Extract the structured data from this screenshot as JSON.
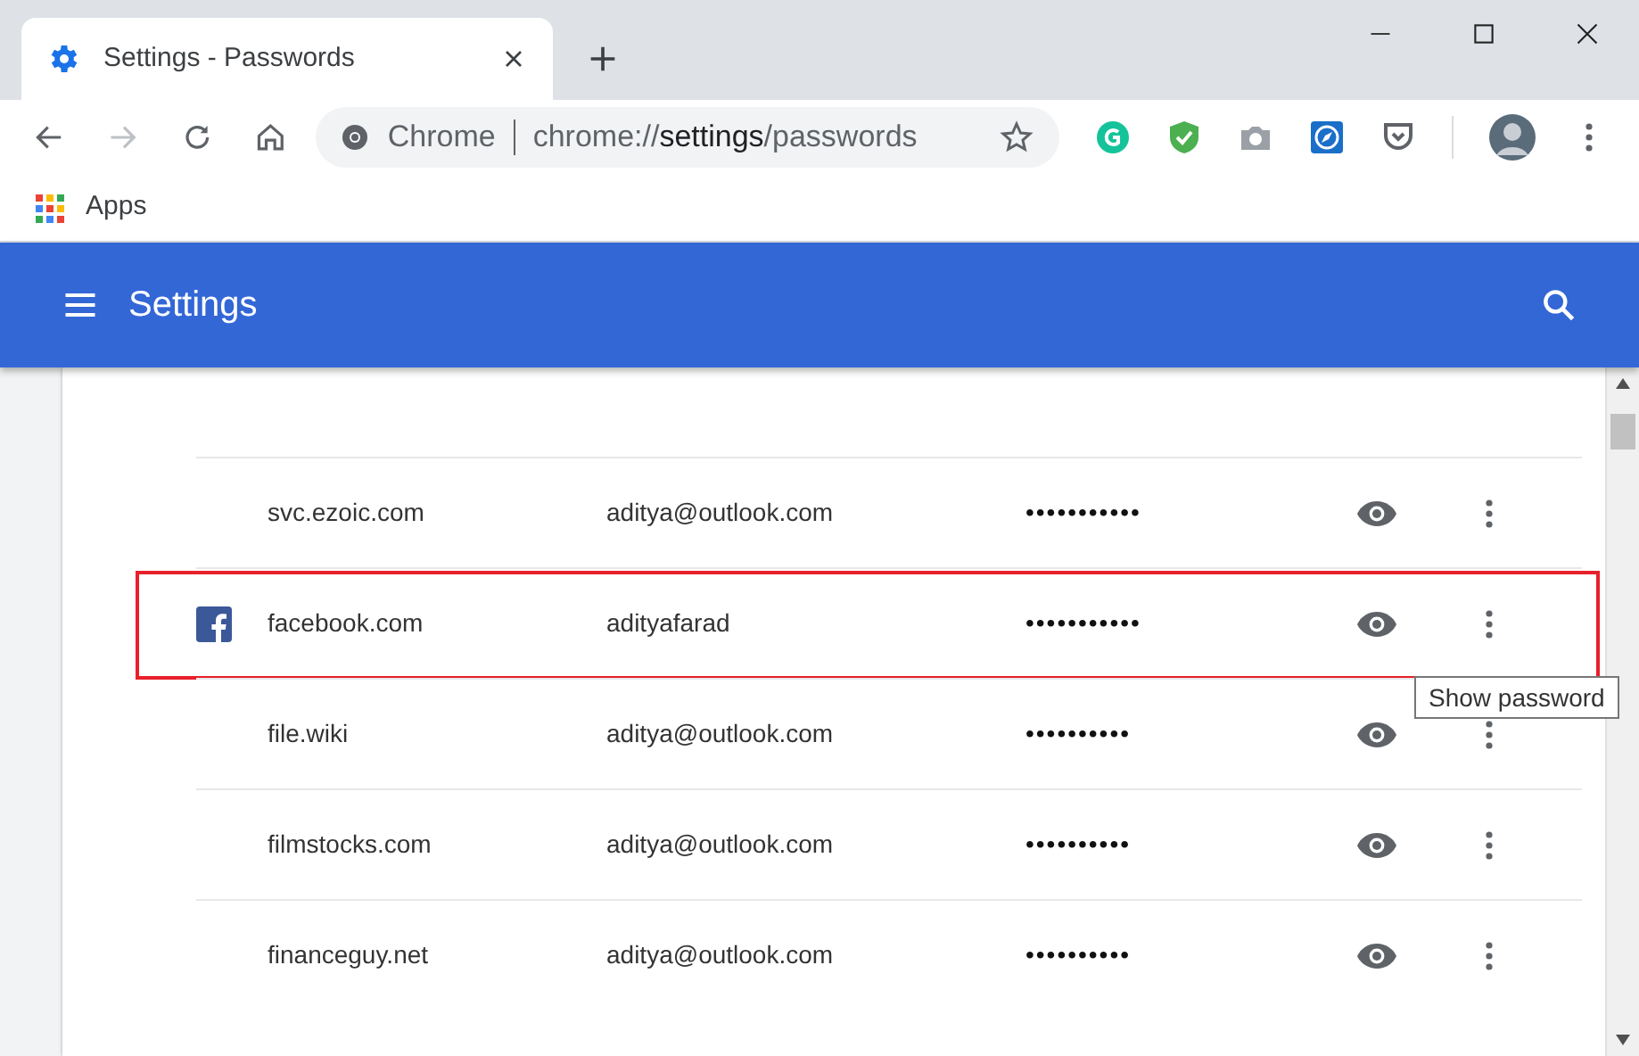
{
  "tab": {
    "title": "Settings - Passwords"
  },
  "address": {
    "label": "Chrome",
    "scheme": "chrome://",
    "host": "settings",
    "path": "/passwords"
  },
  "bookmarks": [
    {
      "label": "Apps"
    }
  ],
  "header": {
    "title": "Settings"
  },
  "passwords": [
    {
      "site": "svc.ezoic.com",
      "username": "aditya@outlook.com",
      "password": "•••••••••••",
      "highlighted": false,
      "kind": "plain"
    },
    {
      "site": "facebook.com",
      "username": "adityafarad",
      "password": "•••••••••••",
      "highlighted": true,
      "kind": "facebook"
    },
    {
      "site": "file.wiki",
      "username": "aditya@outlook.com",
      "password": "••••••••••",
      "highlighted": false,
      "kind": "plain"
    },
    {
      "site": "filmstocks.com",
      "username": "aditya@outlook.com",
      "password": "••••••••••",
      "highlighted": false,
      "kind": "plain"
    },
    {
      "site": "financeguy.net",
      "username": "aditya@outlook.com",
      "password": "••••••••••",
      "highlighted": false,
      "kind": "plain"
    }
  ],
  "tooltip": {
    "text": "Show password"
  }
}
